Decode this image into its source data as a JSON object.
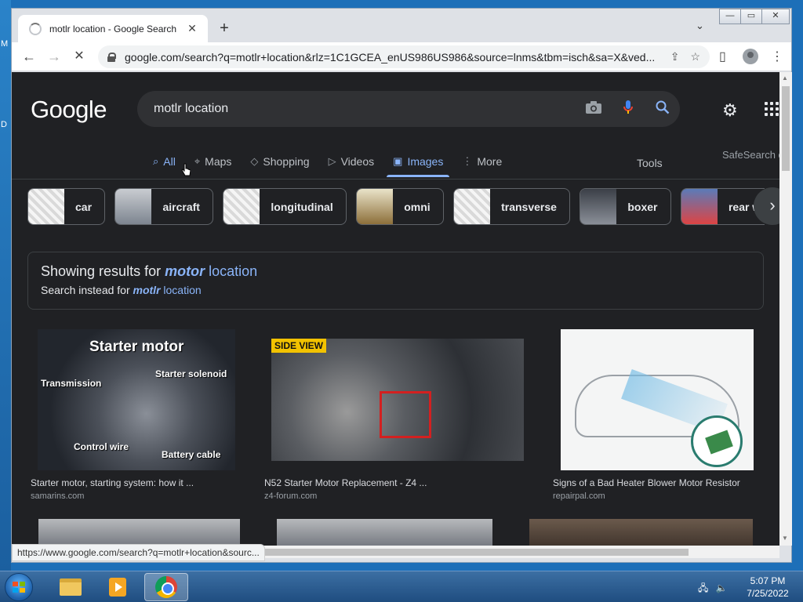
{
  "desktop": {
    "edge_letters": [
      "M",
      "D"
    ]
  },
  "window": {
    "controls": {
      "minimize": "—",
      "restore": "▭",
      "close": "✕"
    }
  },
  "browser": {
    "tab": {
      "title": "motlr location - Google Search",
      "close": "✕"
    },
    "new_tab": "+",
    "tab_menu": "⌄",
    "nav": {
      "back": "←",
      "forward": "→",
      "reload": "✕"
    },
    "address": "google.com/search?q=motlr+location&rlz=1C1GCEA_enUS986US986&source=lnms&tbm=isch&sa=X&ved..."
  },
  "google": {
    "logo": "Google",
    "query": "motlr location",
    "tabs": [
      {
        "label": "All",
        "icon": "search-icon"
      },
      {
        "label": "Maps",
        "icon": "pin-icon"
      },
      {
        "label": "Shopping",
        "icon": "tag-icon"
      },
      {
        "label": "Videos",
        "icon": "play-icon"
      },
      {
        "label": "Images",
        "icon": "image-icon"
      },
      {
        "label": "More",
        "icon": "dots-vertical-icon"
      }
    ],
    "tools": "Tools",
    "safesearch": "SafeSearch o",
    "chips": [
      "car",
      "aircraft",
      "longitudinal",
      "omni",
      "transverse",
      "boxer",
      "rear wheel d"
    ],
    "spelling": {
      "showing_prefix": "Showing results for",
      "corrected_bold": "motor",
      "corrected_rest": "location",
      "instead_prefix": "Search instead for",
      "original_bold": "motlr",
      "original_rest": "location"
    },
    "results": [
      {
        "caption": "Starter motor, starting system: how it ...",
        "source": "samarins.com",
        "labels": {
          "title": "Starter motor",
          "a": "Transmission",
          "b": "Starter solenoid",
          "c": "Control wire",
          "d": "Battery cable"
        }
      },
      {
        "caption": "N52 Starter Motor Replacement - Z4 ...",
        "source": "z4-forum.com",
        "labels": {
          "badge": "SIDE VIEW"
        }
      },
      {
        "caption": "Signs of a Bad Heater Blower Motor Resistor",
        "source": "repairpal.com"
      }
    ]
  },
  "status_url": "https://www.google.com/search?q=motlr+location&sourc...",
  "taskbar": {
    "clock_time": "5:07 PM",
    "clock_date": "7/25/2022"
  }
}
